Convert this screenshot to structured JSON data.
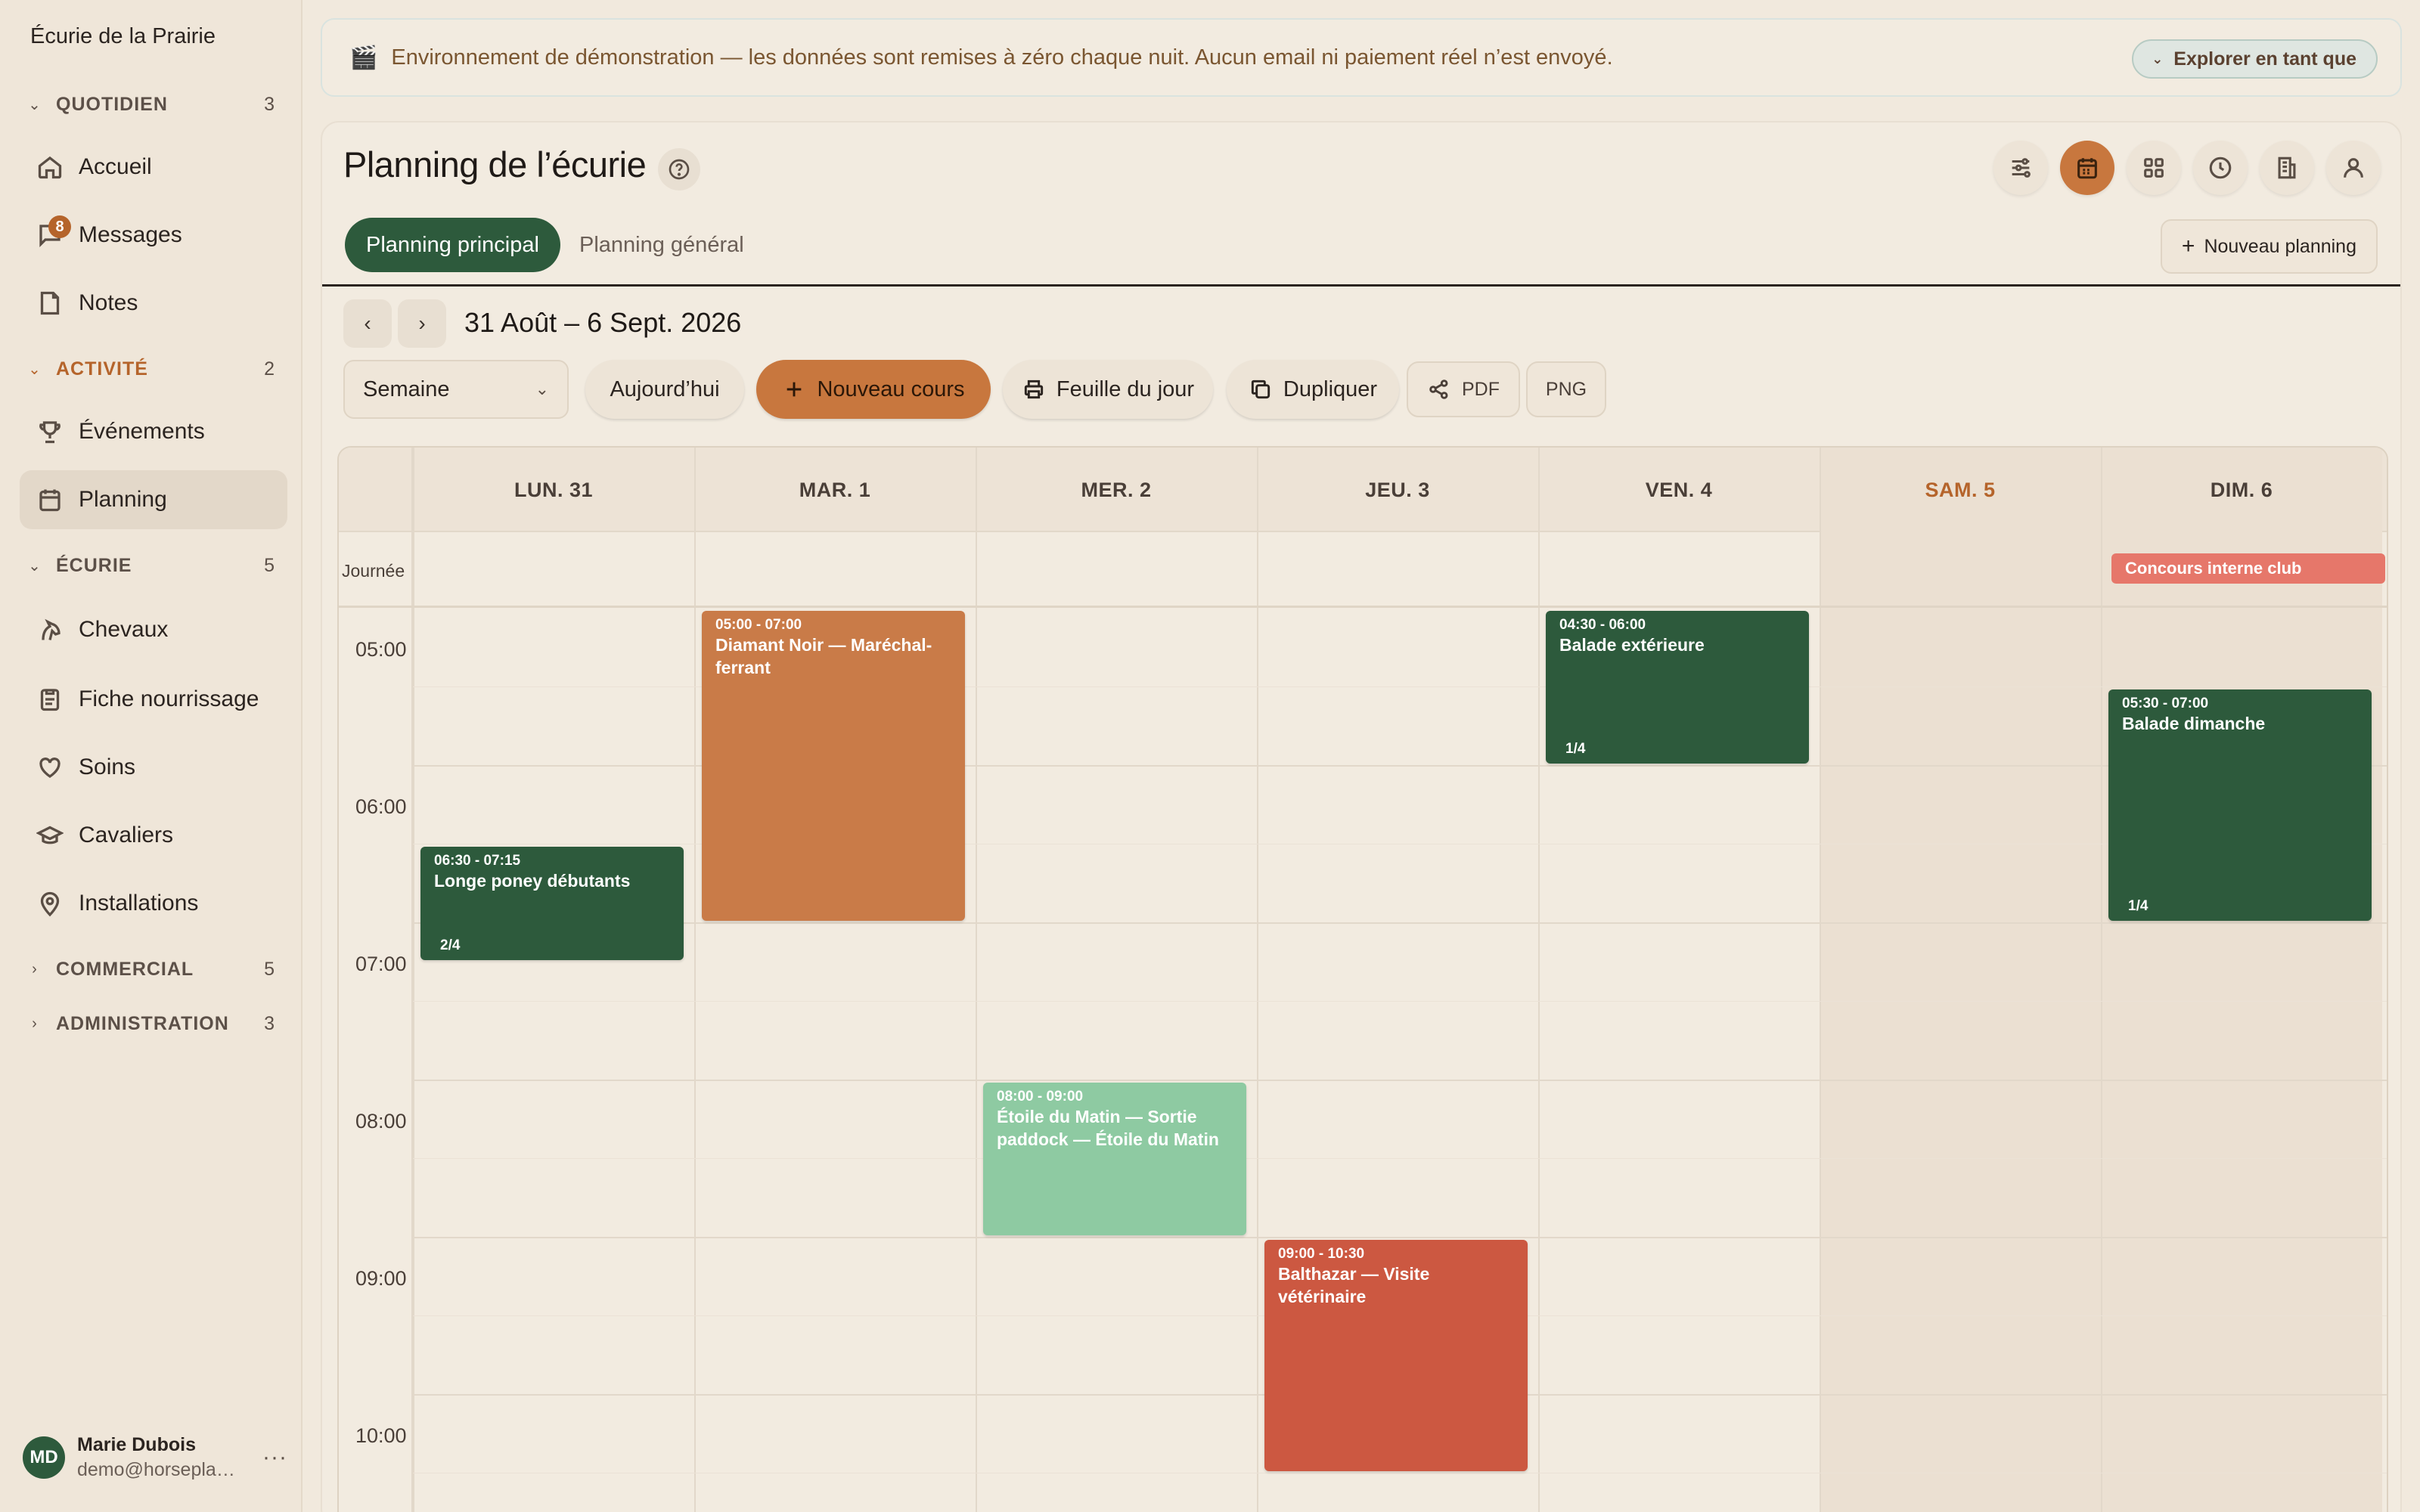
{
  "sidebar": {
    "brand": "Écurie de la Prairie",
    "groups": {
      "quotidien": {
        "label": "QUOTIDIEN",
        "count": "3"
      },
      "activite": {
        "label": "ACTIVITÉ",
        "count": "2"
      },
      "ecurie": {
        "label": "ÉCURIE",
        "count": "5"
      },
      "commercial": {
        "label": "COMMERCIAL",
        "count": "5"
      },
      "administration": {
        "label": "ADMINISTRATION",
        "count": "3"
      }
    },
    "items": {
      "accueil": "Accueil",
      "messages": "Messages",
      "messages_badge": "8",
      "notes": "Notes",
      "evenements": "Événements",
      "planning": "Planning",
      "chevaux": "Chevaux",
      "fiche": "Fiche nourrissage",
      "soins": "Soins",
      "cavaliers": "Cavaliers",
      "installations": "Installations"
    },
    "user": {
      "initials": "MD",
      "name": "Marie Dubois",
      "email": "demo@horsepla…",
      "more": "···"
    }
  },
  "banner": {
    "icon": "clapperboard-icon",
    "text": "Environnement de démonstration — les données sont remises à zéro chaque nuit. Aucun email ni paiement réel n’est envoyé.",
    "explore": "Explorer en tant que"
  },
  "main": {
    "title": "Planning de l’écurie",
    "tabs": {
      "principal": "Planning principal",
      "general": "Planning général"
    },
    "new_planning": "Nouveau planning",
    "date_range": "31 Août – 6 Sept. 2026",
    "view_select": "Semaine",
    "today": "Aujourd’hui",
    "new_course": "Nouveau cours",
    "day_sheet": "Feuille du jour",
    "duplicate": "Dupliquer",
    "pdf": "PDF",
    "png": "PNG"
  },
  "calendar": {
    "days": [
      "LUN. 31",
      "MAR. 1",
      "MER. 2",
      "JEU. 3",
      "VEN. 4",
      "SAM. 5",
      "DIM. 6"
    ],
    "allday_label": "Journée",
    "hours": [
      "05:00",
      "06:00",
      "07:00",
      "08:00",
      "09:00",
      "10:00"
    ],
    "allday_event": "Concours interne club",
    "events": [
      {
        "day": 0,
        "time": "06:30 - 07:15",
        "title": "Longe poney débutants",
        "count": "2/4",
        "color": "#2d5a3c"
      },
      {
        "day": 1,
        "time": "05:00 - 07:00",
        "title": "Diamant Noir — Maréchal-ferrant",
        "count": "",
        "color": "#c97b48"
      },
      {
        "day": 2,
        "time": "08:00 - 09:00",
        "title": "Étoile du Matin — Sortie paddock — Étoile du Matin",
        "count": "",
        "color": "#8ecaa2"
      },
      {
        "day": 3,
        "time": "09:00 - 10:30",
        "title": "Balthazar — Visite vétérinaire",
        "count": "",
        "color": "#cc5841"
      },
      {
        "day": 4,
        "time": "04:30 - 06:00",
        "title": "Balade extérieure",
        "count": "1/4",
        "color": "#2d5a3c"
      },
      {
        "day": 6,
        "time": "05:30 - 07:00",
        "title": "Balade dimanche",
        "count": "1/4",
        "color": "#2d5a3c"
      }
    ]
  },
  "colors": {
    "accent": "#c8773e",
    "primary_green": "#2d5a3c",
    "background": "#f1e9dd"
  }
}
